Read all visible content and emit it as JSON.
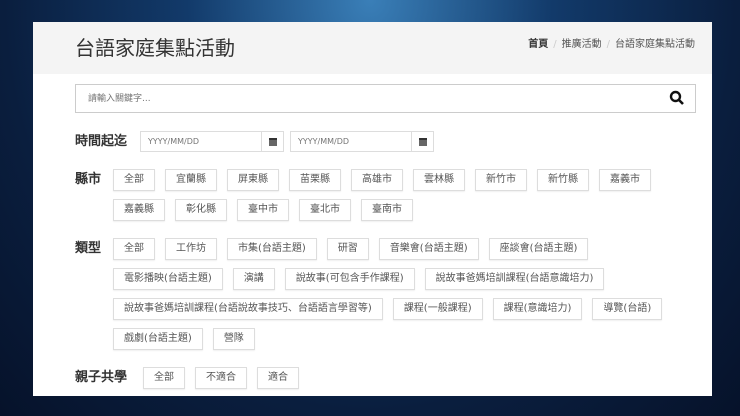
{
  "header": {
    "title": "台語家庭集點活動",
    "breadcrumb": [
      "首頁",
      "推廣活動",
      "台語家庭集點活動"
    ]
  },
  "search": {
    "placeholder": "請輸入關鍵字..."
  },
  "date": {
    "label": "時間起迄",
    "start_placeholder": "YYYY/MM/DD",
    "end_placeholder": "YYYY/MM/DD"
  },
  "county": {
    "label": "縣市",
    "options": [
      "全部",
      "宜蘭縣",
      "屏東縣",
      "苗栗縣",
      "高雄市",
      "雲林縣",
      "新竹市",
      "新竹縣",
      "嘉義市",
      "嘉義縣",
      "彰化縣",
      "臺中市",
      "臺北市",
      "臺南市"
    ]
  },
  "type": {
    "label": "類型",
    "options": [
      "全部",
      "工作坊",
      "市集(台語主題)",
      "研習",
      "音樂會(台語主題)",
      "座談會(台語主題)",
      "電影播映(台語主題)",
      "演講",
      "說故事(可包含手作課程)",
      "說故事爸媽培訓課程(台語意識培力)",
      "說故事爸媽培訓課程(台語說故事技巧、台語語言學習等)",
      "課程(一般課程)",
      "課程(意識培力)",
      "導覽(台語)",
      "戲劇(台語主題)",
      "營隊"
    ]
  },
  "family": {
    "label": "親子共學",
    "options": [
      "全部",
      "不適合",
      "適合"
    ]
  }
}
